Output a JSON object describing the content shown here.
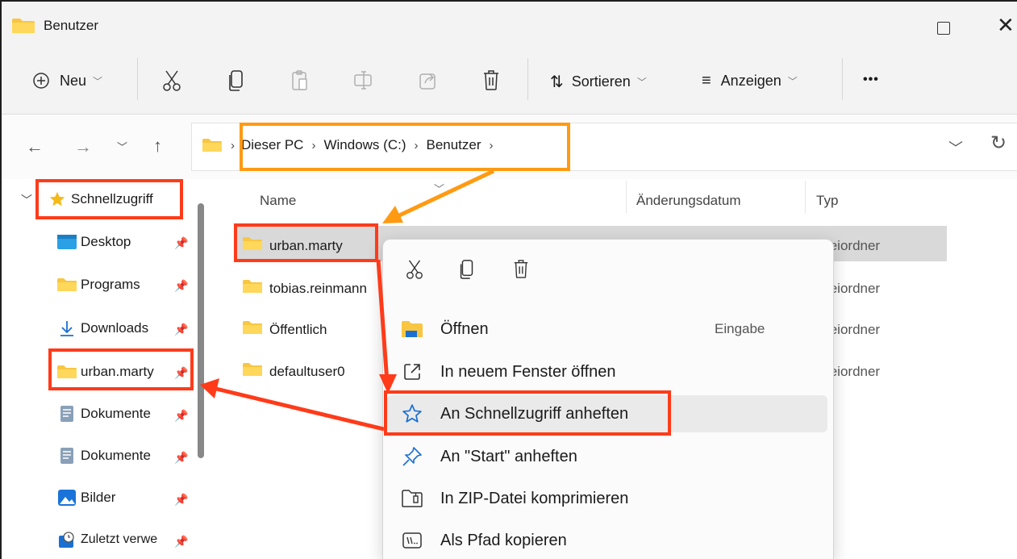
{
  "window": {
    "title": "Benutzer",
    "folder_icon": "folder-icon",
    "maximize_icon": "maximize-icon",
    "close_glyph": "✕"
  },
  "toolbar": {
    "new_label": "Neu",
    "sort_label": "Sortieren",
    "view_label": "Anzeigen",
    "more_label": "•••",
    "icons": [
      "new-icon",
      "cut-icon",
      "copy-icon",
      "paste-icon",
      "rename-icon",
      "share-icon",
      "delete-icon",
      "sort-icon",
      "view-icon"
    ]
  },
  "address": {
    "crumbs": [
      "Dieser PC",
      "Windows (C:)",
      "Benutzer"
    ],
    "separator": "›"
  },
  "sidebar": {
    "quick_access": "Schnellzugriff",
    "items": [
      {
        "label": "Desktop",
        "icon": "desktop-icon"
      },
      {
        "label": "Programs",
        "icon": "folder-icon"
      },
      {
        "label": "Downloads",
        "icon": "download-icon"
      },
      {
        "label": "urban.marty",
        "icon": "folder-icon"
      },
      {
        "label": "Dokumente",
        "icon": "document-icon"
      },
      {
        "label": "Dokumente",
        "icon": "document-icon"
      },
      {
        "label": "Bilder",
        "icon": "pictures-icon"
      },
      {
        "label": "Zuletzt verwe",
        "icon": "recent-icon"
      }
    ]
  },
  "filelist": {
    "columns": [
      "Name",
      "Änderungsdatum",
      "Typ"
    ],
    "rows": [
      {
        "name": "urban.marty",
        "type": "teiordner"
      },
      {
        "name": "tobias.reinmann",
        "type": "teiordner"
      },
      {
        "name": "Öffentlich",
        "type": "teiordner"
      },
      {
        "name": "defaultuser0",
        "type": "teiordner"
      }
    ]
  },
  "context_menu": {
    "top_icons": [
      "cut-icon",
      "copy-icon",
      "delete-icon"
    ],
    "items": [
      {
        "label": "Öffnen",
        "shortcut": "Eingabe",
        "icon": "open-folder-icon"
      },
      {
        "label": "In neuem Fenster öffnen",
        "icon": "new-window-icon"
      },
      {
        "label": "An Schnellzugriff anheften",
        "icon": "star-icon"
      },
      {
        "label": "An \"Start\" anheften",
        "icon": "pin-icon"
      },
      {
        "label": "In ZIP-Datei komprimieren",
        "icon": "zip-icon"
      },
      {
        "label": "Als Pfad kopieren",
        "icon": "copy-path-icon"
      }
    ]
  },
  "colors": {
    "annotation_red": "#ff3b1a",
    "annotation_orange": "#ff9a12",
    "folder_yellow": "#f8c642",
    "selection_gray": "#d9d9d9",
    "accent_blue": "#1a6fd1"
  }
}
